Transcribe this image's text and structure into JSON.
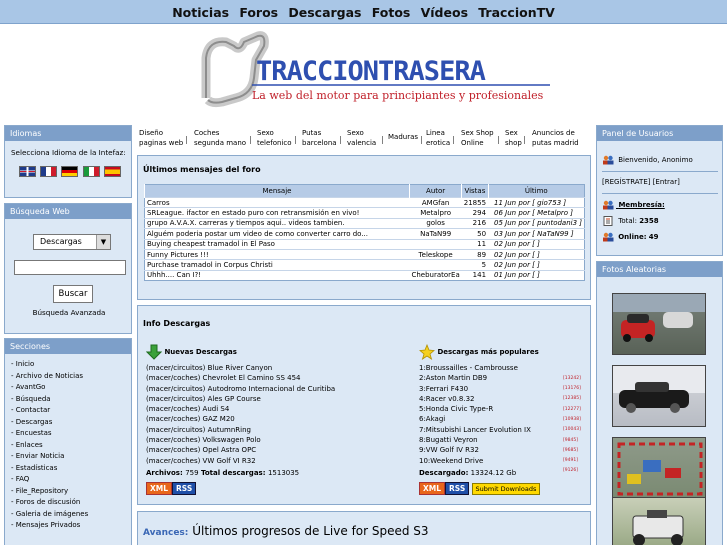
{
  "topnav": [
    "Noticias",
    "Foros",
    "Descargas",
    "Fotos",
    "Vídeos",
    "TraccionTV"
  ],
  "banner": {
    "logo": "TRACCIONTRASERA",
    "tagline": "La web del motor para principiantes y profesionales"
  },
  "idiomas": {
    "title": "Idiomas",
    "label": "Selecciona Idioma de la Intefaz:",
    "flags": [
      "uk-flag-icon",
      "fr-flag-icon",
      "de-flag-icon",
      "it-flag-icon",
      "es-flag-icon"
    ]
  },
  "busqueda": {
    "title": "Búsqueda Web",
    "select": "Descargas",
    "button": "Buscar",
    "advanced": "Búsqueda Avanzada"
  },
  "secciones": {
    "title": "Secciones",
    "items": [
      "- Inicio",
      "- Archivo de Noticias",
      "- AvantGo",
      "- Búsqueda",
      "- Contactar",
      "- Descargas",
      "- Encuestas",
      "- Enlaces",
      "- Enviar Noticia",
      "- Estadísticas",
      "- FAQ",
      "- File_Repository",
      "- Foros de discusión",
      "- Galeria de imágenes",
      "- Mensajes Privados"
    ]
  },
  "linkbar": [
    {
      "text": "Diseño\npaginas web"
    },
    {
      "text": "Coches\nsegunda mano"
    },
    {
      "text": "Sexo\ntelefonico"
    },
    {
      "text": "Putas\nbarcelona"
    },
    {
      "text": "Sexo\nvalencia"
    },
    {
      "text": "Maduras"
    },
    {
      "text": "Linea\nerotica"
    },
    {
      "text": "Sex Shop\nOnline"
    },
    {
      "text": "Sex\nshop"
    },
    {
      "text": "Anuncios de\nputas madrid"
    }
  ],
  "foro": {
    "title": "Últimos mensajes del foro",
    "headers": [
      "Mensaje",
      "Autor",
      "Vistas",
      "Último"
    ],
    "rows": [
      [
        "Carros",
        "AMGfan",
        "21855",
        "11 Jun por [ gio753 ]"
      ],
      [
        "SRLeague. ifactor en estado puro con retransmisión en vivo!",
        "Metalpro",
        "294",
        "06 Jun por [ Metalpro ]"
      ],
      [
        "grupo A.V.A.X. carreras y tiempos aqui.. videos tambien.",
        "golos",
        "216",
        "05 Jun por [ puntodani3 ]"
      ],
      [
        "Alguém poderia postar um video de como converter carro do...",
        "NaTaN99",
        "50",
        "03 Jun por [ NaTaN99 ]"
      ],
      [
        "Buying cheapest tramadol in El Paso",
        "",
        "11",
        "02 Jun por [ ]"
      ],
      [
        "Funny Pictures !!!",
        "Teleskope",
        "89",
        "02 Jun por [ ]"
      ],
      [
        "Purchase tramadol in Corpus Christi",
        "",
        "5",
        "02 Jun por [ ]"
      ],
      [
        "Uhhh.... Can I?!",
        "CheburatorEa",
        "141",
        "01 Jun por [ ]"
      ]
    ]
  },
  "descargas": {
    "title": "Info Descargas",
    "nuevas_title": "Nuevas Descargas",
    "nuevas": [
      "(macer/circuitos) Blue River Canyon",
      "(macer/coches) Chevrolet El Camino SS 454",
      "(macer/circuitos) Autodromo Internacional de Curitiba",
      "(macer/circuitos) Ales GP Course",
      "(macer/coches) Audi S4",
      "(macer/coches) GAZ M20",
      "(macer/circuitos) AutumnRing",
      "(macer/coches) Volkswagen Polo",
      "(macer/coches) Opel Astra OPC",
      "(macer/coches) VW Golf VI R32"
    ],
    "archivos_label": "Archivos:",
    "archivos_value": "759",
    "total_label": "Total descargas:",
    "total_value": "1513035",
    "populares_title": "Descargas más populares",
    "populares": [
      {
        "name": "1:Broussailles - Cambrousse",
        "count": "[13242]"
      },
      {
        "name": "2:Aston Martin DB9",
        "count": "[13176]"
      },
      {
        "name": "3:Ferrari F430",
        "count": "[12385]"
      },
      {
        "name": "4:Racer v0.8.32",
        "count": "[12277]"
      },
      {
        "name": "5:Honda Civic Type-R",
        "count": "[10938]"
      },
      {
        "name": "6:Akagi",
        "count": "[10043]"
      },
      {
        "name": "7:Mitsubishi Lancer Evolution IX",
        "count": "[9845]"
      },
      {
        "name": "8:Bugatti Veyron",
        "count": "[9685]"
      },
      {
        "name": "9:VW Golf IV R32",
        "count": "[9491]"
      },
      {
        "name": "10:Weekend Drive",
        "count": "[9126]"
      }
    ],
    "descargado_label": "Descargado:",
    "descargado_value": "13324.12 Gb",
    "xml": "XML",
    "rss": "RSS",
    "submit": "Submit Downloads"
  },
  "avances": {
    "label": "Avances:",
    "title": "Últimos progresos de Live for Speed S3"
  },
  "usuarios": {
    "title": "Panel de Usuarios",
    "welcome": "Bienvenido, Anonimo",
    "links": "[REGÍSTRATE] [Entrar]",
    "membresia": "Membresía:",
    "total_label": "Total:",
    "total_value": "2358",
    "online_label": "Online:",
    "online_value": "49"
  },
  "fotos": {
    "title": "Fotos Aleatorias"
  },
  "colors": {
    "nav_bg": "#a9c6e6",
    "panel_header": "#7d9fc9",
    "panel_bg": "#dce8f5",
    "accent_red": "#c0202a",
    "logo_blue": "#2e4fb0"
  }
}
